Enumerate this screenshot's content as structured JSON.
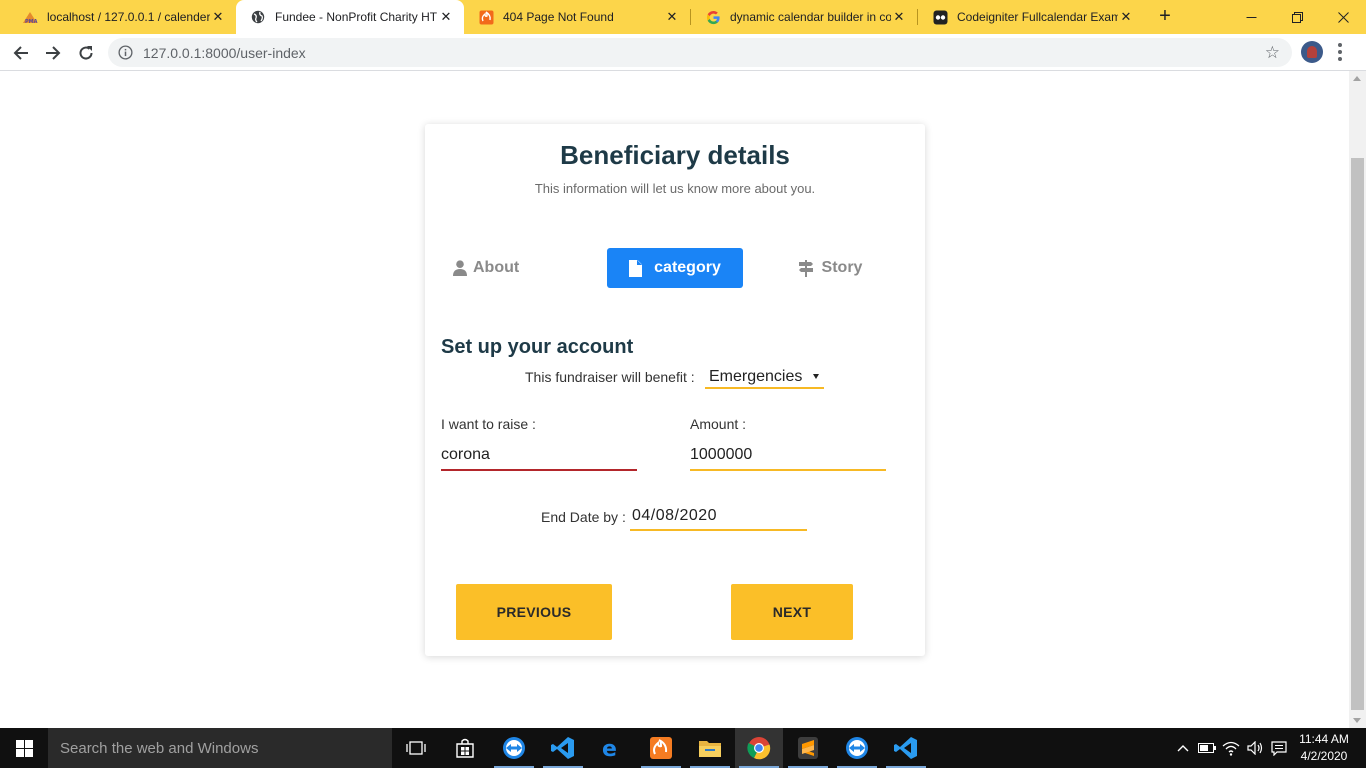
{
  "browser": {
    "tabs": [
      {
        "title": "localhost / 127.0.0.1 / calender",
        "icon": "phpmyadmin-icon",
        "close": "✕"
      },
      {
        "title": "Fundee - NonProfit Charity HT",
        "icon": "globe-icon",
        "close": "✕"
      },
      {
        "title": "404 Page Not Found",
        "icon": "codeigniter-icon",
        "close": "✕"
      },
      {
        "title": "dynamic calendar builder in co",
        "icon": "google-icon",
        "close": "✕"
      },
      {
        "title": "Codeigniter Fullcalendar Examp",
        "icon": "site-icon",
        "close": "✕"
      }
    ],
    "new_tab": "+",
    "url": "127.0.0.1:8000/user-index",
    "bookmark": "☆"
  },
  "page": {
    "title": "Beneficiary details",
    "subtitle": "This information will let us know more about you.",
    "steps": [
      {
        "label": "About",
        "icon": "user-icon",
        "active": false
      },
      {
        "label": "category",
        "icon": "document-icon",
        "active": true
      },
      {
        "label": "Story",
        "icon": "signpost-icon",
        "active": false
      }
    ],
    "section_title": "Set up your account",
    "benefit": {
      "label": "This fundraiser will benefit :",
      "selected": "Emergencies"
    },
    "raise": {
      "label": "I want to raise :",
      "value": "corona"
    },
    "amount": {
      "label": "Amount :",
      "value": "1000000"
    },
    "end_date": {
      "label": "End Date by :",
      "value": "04/08/2020"
    },
    "buttons": {
      "previous": "PREVIOUS",
      "next": "NEXT"
    }
  },
  "taskbar": {
    "search_placeholder": "Search the web and Windows",
    "apps": [
      "task-view-icon",
      "store-icon",
      "teamviewer-icon",
      "vscode-icon",
      "edge-icon",
      "xampp-icon",
      "file-explorer-icon",
      "chrome-icon",
      "sublime-icon",
      "teamviewer-icon",
      "vscode-icon"
    ],
    "time": "11:44 AM",
    "date": "4/2/2020"
  },
  "colors": {
    "tabstrip": "#fcd54a",
    "accent_blue": "#1a84f6",
    "button_yellow": "#fbbf28",
    "underline_yellow": "#f7b924",
    "underline_invalid": "#b3262b",
    "heading": "#1e3a47"
  }
}
